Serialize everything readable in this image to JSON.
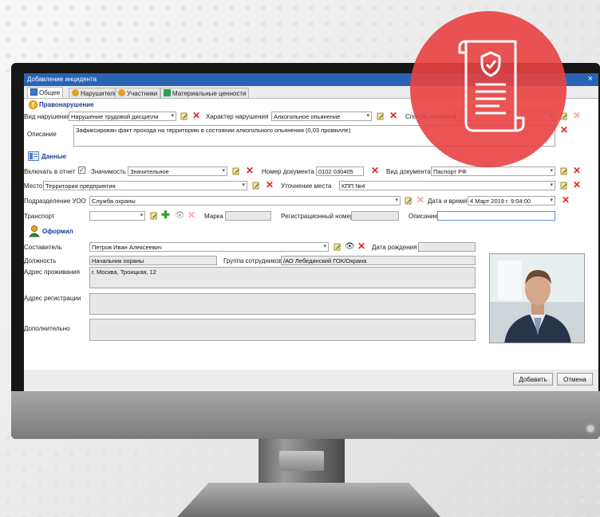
{
  "window": {
    "title": "Добавление инцидента"
  },
  "tabs": [
    {
      "label": "Общее",
      "active": true
    },
    {
      "label": "Нарушители"
    },
    {
      "label": "Участники"
    },
    {
      "label": "Материальные ценности"
    }
  ],
  "offense": {
    "section_title": "Правонарушение",
    "violation_type_label": "Вид нарушения",
    "violation_type_value": "Нарушение трудовой дисципли",
    "character_label": "Характер нарушения",
    "character_value": "Алкогольное опьянение",
    "method_label": "Способ хищения",
    "method_value": "",
    "description_label": "Описание",
    "description_value": "Зафиксирован факт прохода на территорию в состоянии алкогольного опьянения (0,03 промилле)"
  },
  "data": {
    "section_title": "Данные",
    "include_label": "Включать в отчет",
    "include_checked": "✓",
    "importance_label": "Значимость",
    "importance_value": "Значительное",
    "doc_number_label": "Номер документа",
    "doc_number_value": "0102 030405",
    "doc_type_label": "Вид документа",
    "doc_type_value": "Паспорт РФ",
    "place_label": "Место",
    "place_value": "Территория предприятия",
    "place_detail_label": "Уточнение места",
    "place_detail_value": "КПП №4",
    "division_label": "Подразделение УОО",
    "division_value": "Служба охраны",
    "datetime_label": "Дата и время",
    "datetime_value": "4 Март 2019 г. 9:04:00",
    "transport_label": "Транспорт",
    "transport_value": "",
    "brand_label": "Марка",
    "brand_value": "",
    "reg_number_label": "Регистрационный номер",
    "reg_number_value": "",
    "desc2_label": "Описание",
    "desc2_value": ""
  },
  "registered": {
    "section_title": "Оформил",
    "author_label": "Составитель",
    "author_value": "Петров Иван Алексеевич",
    "birth_label": "Дата рождения",
    "birth_value": "",
    "position_label": "Должность",
    "position_value": "Начальник охраны",
    "group_label": "Группа сотрудников",
    "group_value": "/АО Лебединский ГОК/Охрана",
    "address_label": "Адрес проживания",
    "address_value": "г. Москва, Троицкая, 12",
    "reg_address_label": "Адрес регистрации",
    "reg_address_value": "",
    "additional_label": "Дополнительно",
    "additional_value": ""
  },
  "footer": {
    "add_label": "Добавить",
    "cancel_label": "Отмена"
  },
  "icons": [
    "info-icon",
    "data-icon",
    "user-icon",
    "edit-icon",
    "delete-icon",
    "add-icon",
    "view-icon",
    "dropdown-icon",
    "document-shield-icon"
  ],
  "colors": {
    "titlebar": "#2a63b4",
    "section": "#1a3c99",
    "delete": "#e0261a",
    "add": "#2d9e2d",
    "badge": "#e84141"
  }
}
